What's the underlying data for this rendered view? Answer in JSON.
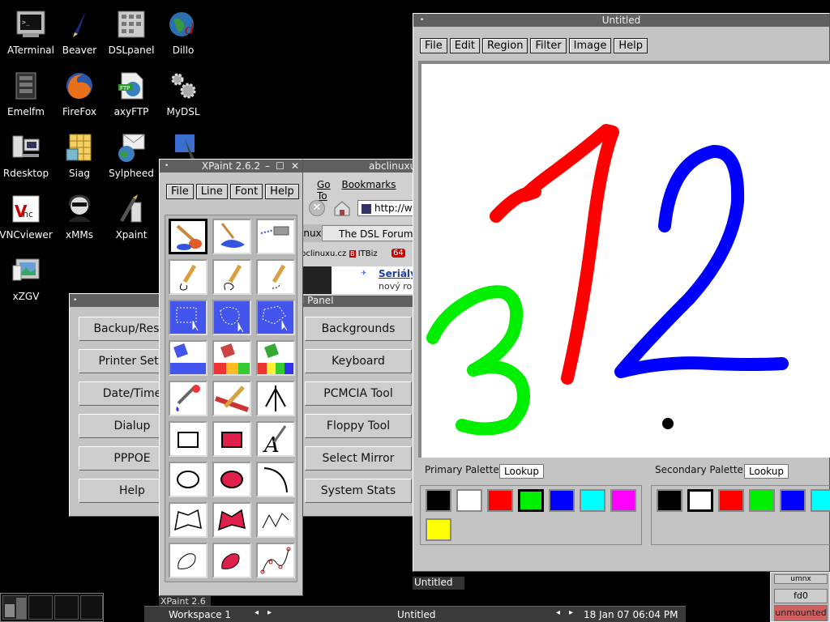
{
  "desktop_icons": [
    {
      "label": "ATerminal",
      "icon": "terminal-icon"
    },
    {
      "label": "Beaver",
      "icon": "beaver-editor-icon"
    },
    {
      "label": "DSLpanel",
      "icon": "dslpanel-icon"
    },
    {
      "label": "Dillo",
      "icon": "dillo-browser-icon"
    },
    {
      "label": "Emelfm",
      "icon": "file-manager-icon"
    },
    {
      "label": "FireFox",
      "icon": "firefox-icon"
    },
    {
      "label": "axyFTP",
      "icon": "ftp-icon"
    },
    {
      "label": "MyDSL",
      "icon": "mydsl-gears-icon"
    },
    {
      "label": "Rdesktop",
      "icon": "rdesktop-icon"
    },
    {
      "label": "Siag",
      "icon": "spreadsheet-icon"
    },
    {
      "label": "Sylpheed",
      "icon": "email-icon"
    },
    {
      "label": "",
      "icon": "pen-icon"
    },
    {
      "label": "VNCviewer",
      "icon": "vnc-icon"
    },
    {
      "label": "xMMs",
      "icon": "xmms-icon"
    },
    {
      "label": "Xpaint",
      "icon": "xpaint-icon"
    },
    {
      "label": "xZGV",
      "icon": "image-viewer-icon"
    }
  ],
  "control_panel": {
    "title": "l Panel",
    "left_buttons": [
      "Backup/Resto",
      "Printer Setu",
      "Date/Time",
      "Dialup",
      "PPPOE",
      "Help"
    ],
    "right_buttons": [
      "Backgrounds",
      "Keyboard",
      "PCMCIA Tool",
      "Floppy Tool",
      "Select Mirror",
      "System Stats"
    ]
  },
  "browser": {
    "title": "abclinuxu",
    "menu": [
      "Go",
      "Bookmarks",
      "To"
    ],
    "url": "http://w",
    "tabs": [
      "inux",
      "The DSL Forum"
    ],
    "bookmarks": [
      "bclinuxu.cz",
      "ITBiz",
      "64"
    ],
    "link": "Seriály",
    "link_sub": "nový ro"
  },
  "xpaint_toolbox": {
    "title": "XPaint 2.6.2",
    "menu": [
      "File",
      "Line",
      "Font",
      "Help"
    ],
    "tools": [
      "paintbrush-tool-icon",
      "fill-brush-tool-icon",
      "spray-tool-icon",
      "pencil-tool-icon",
      "pencil-loop-tool-icon",
      "dotted-pencil-tool-icon",
      "select-rect-tool-icon",
      "select-lasso-tool-icon",
      "select-poly-tool-icon",
      "fill-tool-icon",
      "gradient-fill-tool-icon",
      "rainbow-fill-tool-icon",
      "dropper-tool-icon",
      "ruler-tool-icon",
      "arrow-tool-icon",
      "rectangle-tool-icon",
      "filled-rectangle-tool-icon",
      "text-tool-icon",
      "ellipse-tool-icon",
      "filled-ellipse-tool-icon",
      "arc-tool-icon",
      "polygon-tool-icon",
      "filled-polygon-tool-icon",
      "polyline-tool-icon",
      "freehand-shape-tool-icon",
      "filled-freehand-tool-icon",
      "bezier-tool-icon"
    ],
    "selected_tool": 0
  },
  "paint_window": {
    "title": "Untitled",
    "menu": [
      "File",
      "Edit",
      "Region",
      "Filter",
      "Image",
      "Help"
    ],
    "primary_palette_label": "Primary Palette",
    "secondary_palette_label": "Secondary Palette",
    "lookup_label": "Lookup",
    "primary_colors": [
      "#000000",
      "#ffffff",
      "#ff0000",
      "#00ee00",
      "#0000ff",
      "#00ffff",
      "#ff00ff",
      "#ffff00"
    ],
    "secondary_colors": [
      "#000000",
      "#ffffff",
      "#ff0000",
      "#00ee00",
      "#0000ff",
      "#00ffff",
      "#ffff00"
    ],
    "primary_selected": 3,
    "secondary_selected": 1,
    "stroke_colors": {
      "red": "#ff0000",
      "blue": "#0000ff",
      "green": "#00ee00",
      "dot": "#000000"
    }
  },
  "taskbar": {
    "workspace": "Workspace 1",
    "active_window": "Untitled",
    "clock": "18 Jan 07 06:04 PM",
    "minimized_untitled": "Untitled",
    "minimized_xpaint": "XPaint 2.6",
    "drive_label": "fd0",
    "mount_status": "unmounted",
    "mount_partial": "umnx"
  }
}
